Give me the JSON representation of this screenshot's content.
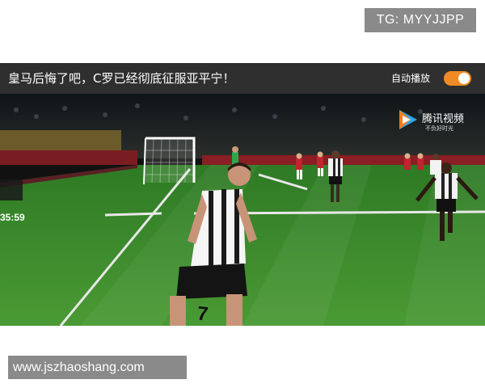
{
  "watermark": {
    "telegram": "TG: MYYJJPP",
    "website": "www.jszhaoshang.com"
  },
  "video": {
    "title": "皇马后悔了吧，C罗已经彻底征服亚平宁！",
    "autoplay_label": "自动播放",
    "autoplay_on": true,
    "match_clock": "35:59",
    "player_number": "7",
    "logo": {
      "name": "腾讯视频",
      "tagline": "不负好时光"
    }
  },
  "colors": {
    "toggle": "#f08a24",
    "titlebar": "#2f2f2f",
    "pitch": "#3f8f2c"
  }
}
